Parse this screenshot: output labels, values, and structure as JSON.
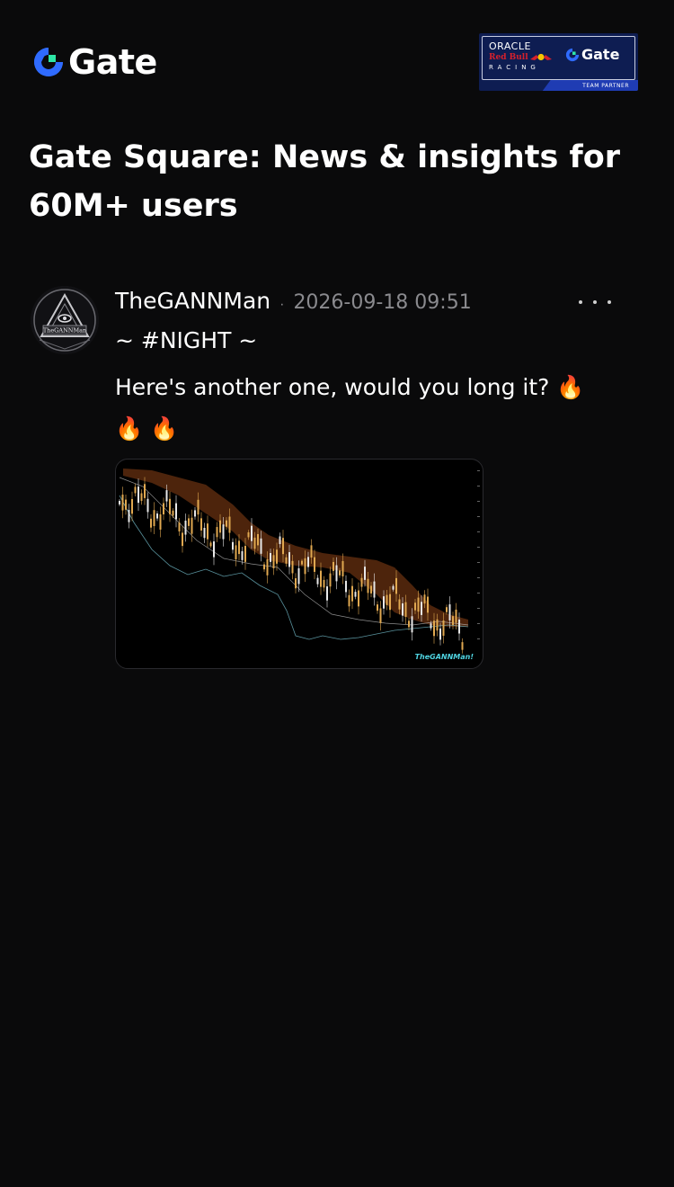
{
  "header": {
    "logo_text": "Gate",
    "partner_badge": {
      "line1": "ORACLE",
      "line2": "Red Bull",
      "line3": "RACING",
      "brand": "Gate",
      "footer": "TEAM PARTNER"
    }
  },
  "page_title": "Gate Square: News & insights for 60M+ users",
  "post": {
    "author": "TheGANNMan",
    "avatar_text": "TheGANNMan",
    "timestamp": "2026-09-18 09:51",
    "tag": "~ #NIGHT ~",
    "body": "Here's another one, would you long it? 🔥 🔥 🔥",
    "image_watermark": "TheGANNMan!"
  },
  "colors": {
    "background": "#0a0a0b",
    "text": "#ffffff",
    "muted": "#8a8a8e",
    "gate_blue": "#2f6bff",
    "gate_green": "#2ee6a6",
    "cloud": "#5a2a0e"
  },
  "icons": {
    "logo": "gate-logo-icon",
    "more": "more-dots-icon",
    "fire": "fire-emoji"
  }
}
